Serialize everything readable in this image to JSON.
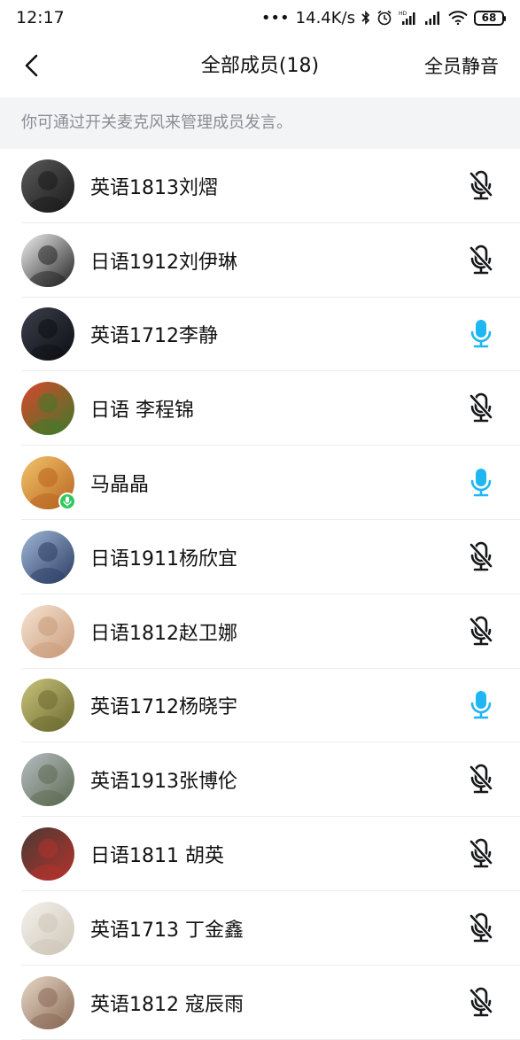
{
  "status_bar": {
    "time": "12:17",
    "dots": "•••",
    "speed": "14.4K/s",
    "battery": "68"
  },
  "nav": {
    "back_icon": "chevron-left-icon",
    "title": "全部成员(18)",
    "action": "全员静音"
  },
  "hint": "你可通过开关麦克风来管理成员发言。",
  "colors": {
    "mic_active": "#1fb6f2",
    "mic_muted": "#16171a",
    "speaking_badge": "#2ec95c",
    "hint_bg": "#f3f4f6"
  },
  "members": [
    {
      "name": "英语1813刘熠",
      "mic": "muted",
      "avatar": [
        "#5a5a5a",
        "#1a1a1a"
      ]
    },
    {
      "name": "日语1912刘伊琳",
      "mic": "muted",
      "avatar": [
        "#f0f0f0",
        "#222222"
      ]
    },
    {
      "name": "英语1712李静",
      "mic": "active",
      "avatar": [
        "#3b3f4a",
        "#0d0f14"
      ]
    },
    {
      "name": "日语 李程锦",
      "mic": "muted",
      "avatar": [
        "#d9462c",
        "#3f7a2a"
      ]
    },
    {
      "name": "马晶晶",
      "mic": "active",
      "avatar": [
        "#f2c46b",
        "#b8641f"
      ],
      "speaking": true
    },
    {
      "name": "日语1911杨欣宜",
      "mic": "muted",
      "avatar": [
        "#9fb6d6",
        "#2c3e63"
      ]
    },
    {
      "name": "日语1812赵卫娜",
      "mic": "muted",
      "avatar": [
        "#f6e4d2",
        "#c99b7a"
      ]
    },
    {
      "name": "英语1712杨晓宇",
      "mic": "active",
      "avatar": [
        "#c9c27a",
        "#6b6a2f"
      ]
    },
    {
      "name": "英语1913张博伦",
      "mic": "muted",
      "avatar": [
        "#b7bcc2",
        "#5c6b52"
      ]
    },
    {
      "name": "日语1811 胡英",
      "mic": "muted",
      "avatar": [
        "#4a3a34",
        "#b3322c"
      ]
    },
    {
      "name": "英语1713 丁金鑫",
      "mic": "muted",
      "avatar": [
        "#f4f1ec",
        "#cfc6b8"
      ]
    },
    {
      "name": "英语1812 寇辰雨",
      "mic": "muted",
      "avatar": [
        "#e7d7c7",
        "#8a6a55"
      ]
    }
  ]
}
